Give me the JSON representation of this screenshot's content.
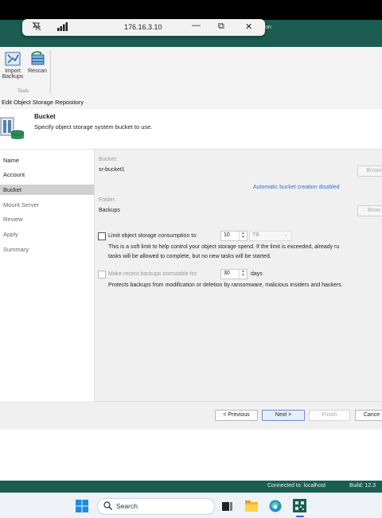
{
  "remote_bar": {
    "title": "176.16.3.10",
    "min": "—",
    "restore": "⧉",
    "close": "✕"
  },
  "app": {
    "title_fragment": "on"
  },
  "ribbon": {
    "buttons": [
      {
        "label": "Import Backups"
      },
      {
        "label": "Rescan"
      }
    ],
    "group_label": "Tools"
  },
  "wizard": {
    "window_title": "Edit Object Storage Repository",
    "step_title": "Bucket",
    "step_description": "Specify object storage system bucket to use.",
    "nav": [
      "Name",
      "Account",
      "Bucket",
      "Mount Server",
      "Review",
      "Apply",
      "Summary"
    ],
    "bucket_label": "Bucket:",
    "bucket_value": "sr-bucket1",
    "browse_label": "Brows",
    "auto_bucket_link": "Automatic bucket creation disabled",
    "folder_label": "Folder:",
    "folder_value": "Backups",
    "browse2_label": "Brow",
    "limit_label": "Limit object storage consumption to:",
    "limit_value": "10",
    "limit_unit": "TB",
    "limit_help_1": "This is a soft limit to help control your object storage spend. If the limit is exceeded, already ru",
    "limit_help_2": "tasks will be allowed to complete, but no new tasks will be started.",
    "immutable_label": "Make recent backups immutable for:",
    "immutable_value": "30",
    "immutable_unit": "days",
    "immutable_help": "Protects backups from modification or deletion by ransomware, malicious insiders and hackers.",
    "buttons": {
      "previous": "< Previous",
      "next": "Next >",
      "finish": "Finish",
      "cancel": "Cance"
    }
  },
  "status": {
    "connected": "Connected to: localhost",
    "build": "Build: 12.3"
  },
  "taskbar": {
    "search_placeholder": "Search"
  },
  "colors": {
    "brand": "#1b5e51",
    "link": "#2f6fd6"
  }
}
